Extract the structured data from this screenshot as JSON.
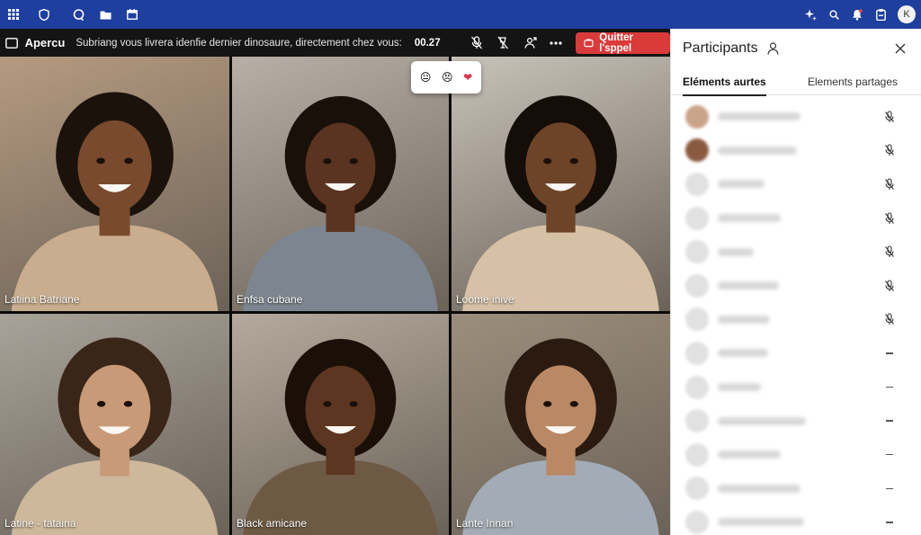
{
  "appbar": {
    "left_icons": [
      "grid-icon",
      "shield-icon",
      "chat-icon",
      "folder-icon",
      "calendar-icon"
    ],
    "right_icons": [
      "sparkle-icon",
      "search-icon",
      "bell-icon",
      "badge-icon"
    ],
    "avatar_initial": "K",
    "color": "#1f3f9e"
  },
  "toolbar": {
    "title": "Apercu",
    "caption": "Subriang vous livrera idenfie dernier dinosaure, directement chez vous:",
    "timer": "00.27",
    "leave_label": "Quitter l'sppel",
    "leave_color": "#d93a3a"
  },
  "reactions": [
    "😐",
    "😣",
    "❤"
  ],
  "tiles": [
    {
      "name": "Latiina Batriane",
      "bg": "#b59a80",
      "shirt": "#c9ad8e",
      "skin": "#7a4a2e",
      "hair": "#1c120c"
    },
    {
      "name": "Enfsa cubane",
      "bg": "#b8b0a6",
      "shirt": "#7d8690",
      "skin": "#5a3420",
      "hair": "#1a100a"
    },
    {
      "name": "Loome inive",
      "bg": "#c8c2b8",
      "shirt": "#d7c1a6",
      "skin": "#6e4428",
      "hair": "#140d08"
    },
    {
      "name": "Latine - tataina",
      "bg": "#a8a39a",
      "shirt": "#cdb89b",
      "skin": "#c99a78",
      "hair": "#3a2618"
    },
    {
      "name": "Black amicane",
      "bg": "#b4aa9c",
      "shirt": "#6e5a44",
      "skin": "#5c3620",
      "hair": "#1a1008"
    },
    {
      "name": "Lante Innan",
      "bg": "#9c8e7c",
      "shirt": "#a3acb6",
      "skin": "#b98865",
      "hair": "#2a1a10"
    }
  ],
  "panel": {
    "title": "Participants",
    "tab_active": "Eléments aurtes",
    "tab_second": "Elements partages"
  },
  "participants": [
    {
      "status": "mic-off-icon",
      "photo": true
    },
    {
      "status": "mic-off-icon",
      "photo": true
    },
    {
      "status": "mic-off-icon",
      "photo": false
    },
    {
      "status": "mic-off-icon",
      "photo": false
    },
    {
      "status": "mic-off-icon",
      "photo": false
    },
    {
      "status": "mic-off-icon",
      "photo": false
    },
    {
      "status": "mic-off-icon",
      "photo": false
    },
    {
      "status": "dash-icon",
      "photo": false
    },
    {
      "status": "dash-icon",
      "photo": false
    },
    {
      "status": "dash-icon",
      "photo": false
    },
    {
      "status": "dash-icon",
      "photo": false
    },
    {
      "status": "dash-icon",
      "photo": false
    },
    {
      "status": "dash-icon",
      "photo": false
    }
  ]
}
